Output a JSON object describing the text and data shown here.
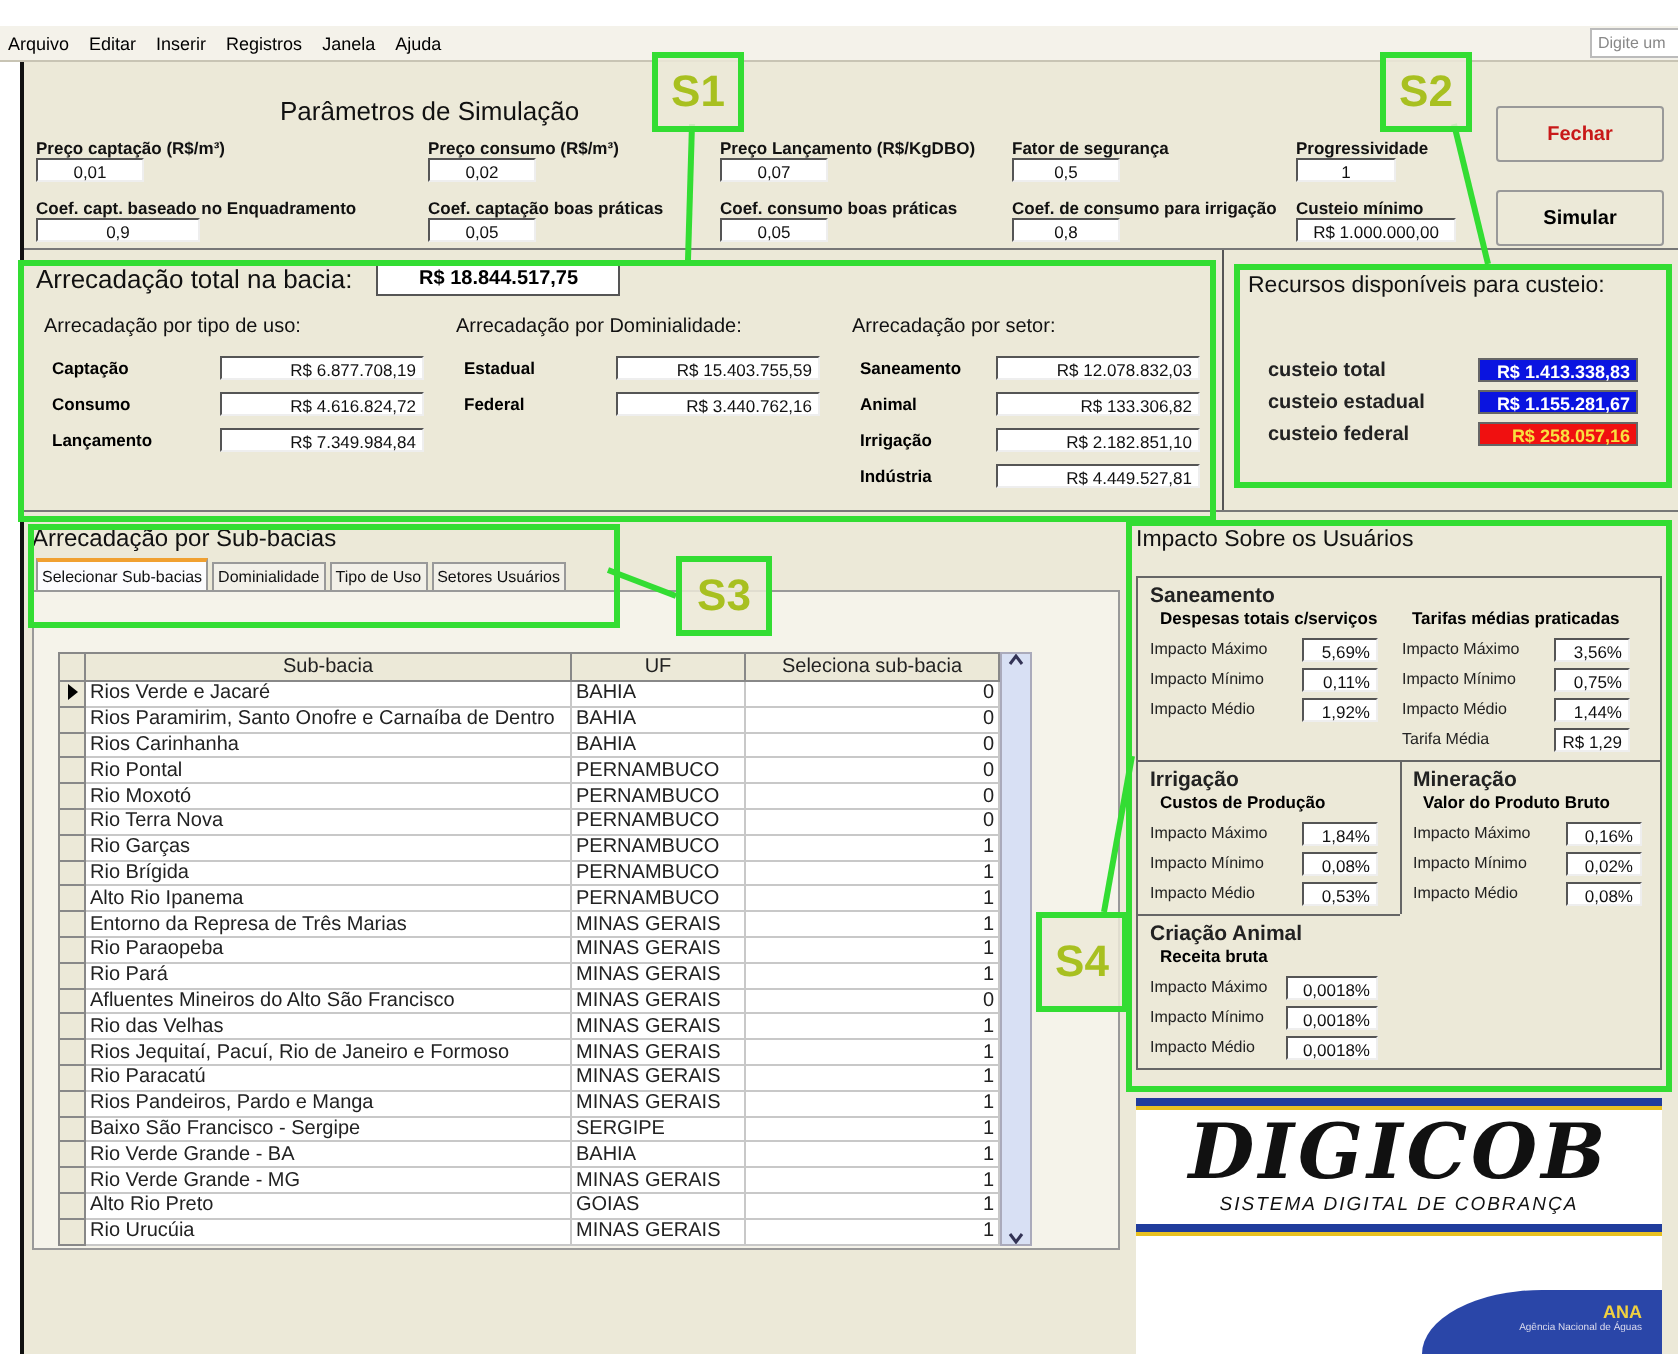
{
  "menu": [
    {
      "label": "Arquivo"
    },
    {
      "label": "Editar"
    },
    {
      "label": "Inserir"
    },
    {
      "label": "Registros"
    },
    {
      "label": "Janela"
    },
    {
      "label": "Ajuda"
    }
  ],
  "help_search": {
    "placeholder": "Digite um"
  },
  "parameters": {
    "title": "Parâmetros de Simulação",
    "fields": [
      {
        "label": "Preço captação (R$/m³)",
        "value": "0,01"
      },
      {
        "label": "Preço consumo (R$/m³)",
        "value": "0,02"
      },
      {
        "label": "Preço Lançamento (R$/KgDBO)",
        "value": "0,07"
      },
      {
        "label": "Fator de segurança",
        "value": "0,5"
      },
      {
        "label": "Progressividade",
        "value": "1"
      },
      {
        "label": "Coef. capt. baseado no Enquadramento",
        "value": "0,9"
      },
      {
        "label": "Coef. captação boas práticas",
        "value": "0,05"
      },
      {
        "label": "Coef. consumo boas práticas",
        "value": "0,05"
      },
      {
        "label": "Coef. de consumo para irrigação",
        "value": "0,8"
      },
      {
        "label": "Custeio mínimo",
        "value": "R$ 1.000.000,00"
      }
    ],
    "buttons": [
      {
        "label": "Fechar",
        "kind": "danger"
      },
      {
        "label": "Simular",
        "kind": "default"
      }
    ]
  },
  "collection": {
    "total_label": "Arrecadação total na bacia:",
    "total_value": "R$ 18.844.517,75",
    "groups": [
      {
        "title": "Arrecadação por tipo de uso:",
        "rows": [
          {
            "label": "Captação",
            "value": "R$ 6.877.708,19"
          },
          {
            "label": "Consumo",
            "value": "R$ 4.616.824,72"
          },
          {
            "label": "Lançamento",
            "value": "R$ 7.349.984,84"
          }
        ]
      },
      {
        "title": "Arrecadação por Dominialidade:",
        "rows": [
          {
            "label": "Estadual",
            "value": "R$ 15.403.755,59"
          },
          {
            "label": "Federal",
            "value": "R$ 3.440.762,16"
          }
        ]
      },
      {
        "title": "Arrecadação por setor:",
        "rows": [
          {
            "label": "Saneamento",
            "value": "R$ 12.078.832,03"
          },
          {
            "label": "Animal",
            "value": "R$ 133.306,82"
          },
          {
            "label": "Irrigação",
            "value": "R$ 2.182.851,10"
          },
          {
            "label": "Indústria",
            "value": "R$ 4.449.527,81"
          }
        ]
      }
    ]
  },
  "resources": {
    "title": "Recursos disponíveis para custeio:",
    "rows": [
      {
        "label": "custeio total",
        "value": "R$ 1.413.338,83",
        "color": "#0a14e0"
      },
      {
        "label": "custeio estadual",
        "value": "R$ 1.155.281,67",
        "color": "#0a14e0"
      },
      {
        "label": "custeio federal",
        "value": "R$ 258.057,16",
        "color": "#f01010"
      }
    ]
  },
  "subbasins": {
    "title": "Arrecadação por Sub-bacias",
    "tabs": [
      {
        "label": "Selecionar Sub-bacias",
        "selected": true
      },
      {
        "label": "Dominialidade",
        "selected": false
      },
      {
        "label": "Tipo de Uso",
        "selected": false
      },
      {
        "label": "Setores Usuários",
        "selected": false
      }
    ],
    "columns": [
      "Sub-bacia",
      "UF",
      "Seleciona sub-bacia"
    ],
    "rows": [
      {
        "current": true,
        "cells": [
          "Rios Verde e Jacaré",
          "BAHIA",
          "0"
        ]
      },
      {
        "current": false,
        "cells": [
          "Rios Paramirim, Santo Onofre e Carnaíba de Dentro",
          "BAHIA",
          "0"
        ]
      },
      {
        "current": false,
        "cells": [
          "Rios Carinhanha",
          "BAHIA",
          "0"
        ]
      },
      {
        "current": false,
        "cells": [
          "Rio Pontal",
          "PERNAMBUCO",
          "0"
        ]
      },
      {
        "current": false,
        "cells": [
          "Rio Moxotó",
          "PERNAMBUCO",
          "0"
        ]
      },
      {
        "current": false,
        "cells": [
          "Rio Terra Nova",
          "PERNAMBUCO",
          "0"
        ]
      },
      {
        "current": false,
        "cells": [
          "Rio Garças",
          "PERNAMBUCO",
          "1"
        ]
      },
      {
        "current": false,
        "cells": [
          "Rio Brígida",
          "PERNAMBUCO",
          "1"
        ]
      },
      {
        "current": false,
        "cells": [
          "Alto Rio Ipanema",
          "PERNAMBUCO",
          "1"
        ]
      },
      {
        "current": false,
        "cells": [
          "Entorno da Represa de Três Marias",
          "MINAS GERAIS",
          "1"
        ]
      },
      {
        "current": false,
        "cells": [
          "Rio Paraopeba",
          "MINAS GERAIS",
          "1"
        ]
      },
      {
        "current": false,
        "cells": [
          "Rio Pará",
          "MINAS GERAIS",
          "1"
        ]
      },
      {
        "current": false,
        "cells": [
          "Afluentes Mineiros do Alto São Francisco",
          "MINAS GERAIS",
          "0"
        ]
      },
      {
        "current": false,
        "cells": [
          "Rio das Velhas",
          "MINAS GERAIS",
          "1"
        ]
      },
      {
        "current": false,
        "cells": [
          "Rios Jequitaí, Pacuí, Rio de Janeiro e Formoso",
          "MINAS GERAIS",
          "1"
        ]
      },
      {
        "current": false,
        "cells": [
          "Rio Paracatú",
          "MINAS GERAIS",
          "1"
        ]
      },
      {
        "current": false,
        "cells": [
          "Rios Pandeiros, Pardo e Manga",
          "MINAS GERAIS",
          "1"
        ]
      },
      {
        "current": false,
        "cells": [
          "Baixo São Francisco - Sergipe",
          "SERGIPE",
          "1"
        ]
      },
      {
        "current": false,
        "cells": [
          "Rio Verde Grande - BA",
          "BAHIA",
          "1"
        ]
      },
      {
        "current": false,
        "cells": [
          "Rio Verde Grande - MG",
          "MINAS GERAIS",
          "1"
        ]
      },
      {
        "current": false,
        "cells": [
          "Alto Rio Preto",
          "GOIAS",
          "1"
        ]
      },
      {
        "current": false,
        "cells": [
          "Rio Urucúia",
          "MINAS GERAIS",
          "1"
        ]
      }
    ]
  },
  "impact": {
    "title": "Impacto Sobre os Usuários",
    "sections": [
      {
        "title": "Saneamento",
        "groups": [
          {
            "subtitle": "Despesas totais c/serviços",
            "rows": [
              {
                "label": "Impacto Máximo",
                "value": "5,69%"
              },
              {
                "label": "Impacto Mínimo",
                "value": "0,11%"
              },
              {
                "label": "Impacto Médio",
                "value": "1,92%"
              }
            ]
          },
          {
            "subtitle": "Tarifas médias praticadas",
            "rows": [
              {
                "label": "Impacto Máximo",
                "value": "3,56%"
              },
              {
                "label": "Impacto Mínimo",
                "value": "0,75%"
              },
              {
                "label": "Impacto Médio",
                "value": "1,44%"
              },
              {
                "label": "Tarifa Média",
                "value": "R$ 1,29"
              }
            ]
          }
        ]
      },
      {
        "title": "Irrigação",
        "groups": [
          {
            "subtitle": "Custos de Produção",
            "rows": [
              {
                "label": "Impacto Máximo",
                "value": "1,84%"
              },
              {
                "label": "Impacto Mínimo",
                "value": "0,08%"
              },
              {
                "label": "Impacto Médio",
                "value": "0,53%"
              }
            ]
          }
        ]
      },
      {
        "title": "Mineração",
        "groups": [
          {
            "subtitle": "Valor do Produto Bruto",
            "rows": [
              {
                "label": "Impacto Máximo",
                "value": "0,16%"
              },
              {
                "label": "Impacto Mínimo",
                "value": "0,02%"
              },
              {
                "label": "Impacto Médio",
                "value": "0,08%"
              }
            ]
          }
        ]
      },
      {
        "title": "Criação Animal",
        "groups": [
          {
            "subtitle": "Receita bruta",
            "rows": [
              {
                "label": "Impacto Máximo",
                "value": "0,0018%"
              },
              {
                "label": "Impacto Mínimo",
                "value": "0,0018%"
              },
              {
                "label": "Impacto Médio",
                "value": "0,0018%"
              }
            ]
          }
        ]
      }
    ]
  },
  "logo": {
    "name": "DIGICOB",
    "tagline": "SISTEMA DIGITAL DE COBRANÇA",
    "agency": "ANA",
    "agency_name": "Agência Nacional de Águas"
  },
  "callouts": [
    {
      "label": "S1"
    },
    {
      "label": "S2"
    },
    {
      "label": "S3"
    },
    {
      "label": "S4"
    }
  ]
}
